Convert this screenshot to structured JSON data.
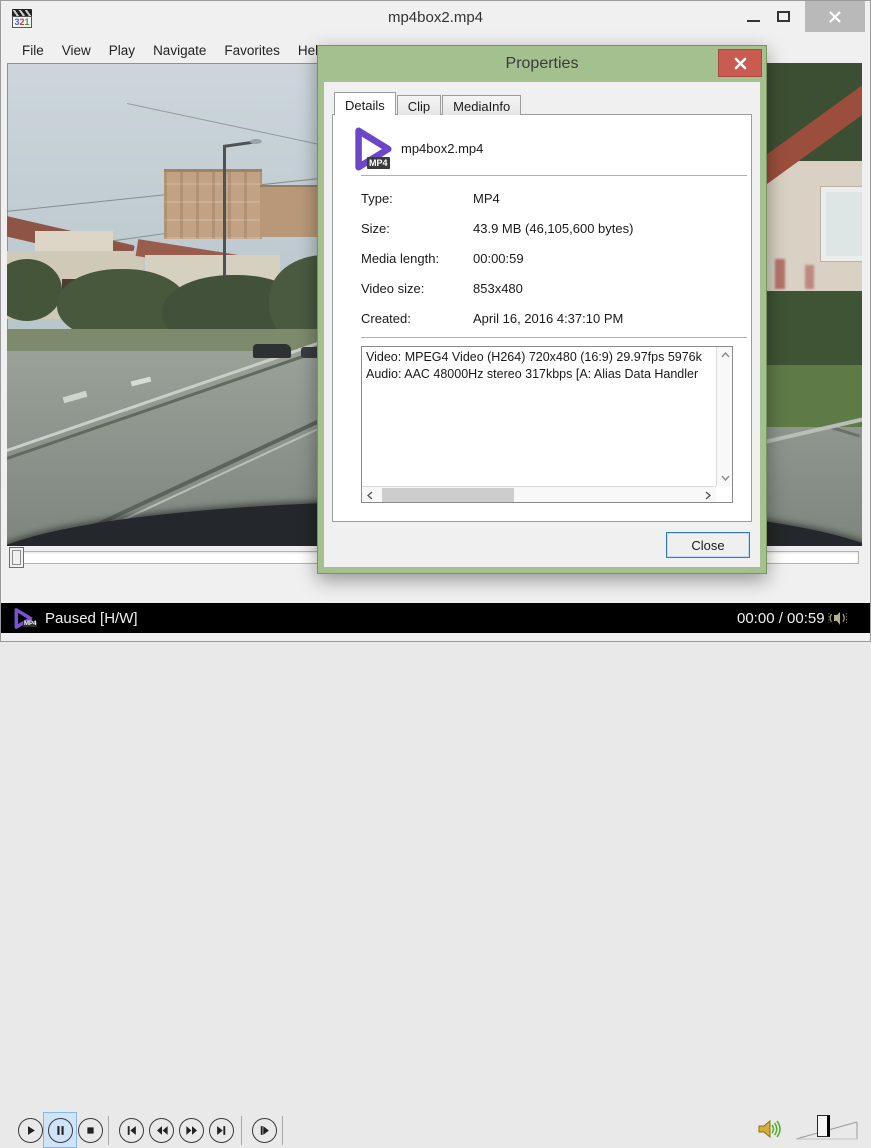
{
  "window": {
    "title": "mp4box2.mp4"
  },
  "menu": {
    "items": [
      "File",
      "View",
      "Play",
      "Navigate",
      "Favorites",
      "Help"
    ]
  },
  "dialog": {
    "title": "Properties",
    "tabs": [
      {
        "label": "Details",
        "active": true
      },
      {
        "label": "Clip",
        "active": false
      },
      {
        "label": "MediaInfo",
        "active": false
      }
    ],
    "file": {
      "name": "mp4box2.mp4",
      "type_badge": "MP4"
    },
    "details": {
      "rows": [
        {
          "label": "Type:",
          "value": "MP4"
        },
        {
          "label": "Size:",
          "value": "43.9 MB (46,105,600 bytes)"
        },
        {
          "label": "Media length:",
          "value": "00:00:59"
        },
        {
          "label": "Video size:",
          "value": "853x480"
        },
        {
          "label": "Created:",
          "value": "April 16, 2016 4:37:10 PM"
        }
      ]
    },
    "stream_info": {
      "line1": "Video: MPEG4 Video (H264) 720x480 (16:9) 29.97fps 5976k",
      "line2": "Audio: AAC 48000Hz stereo 317kbps [A: Alias Data Handler"
    },
    "close_button_label": "Close"
  },
  "transport": {
    "buttons": [
      "play",
      "pause",
      "stop",
      "skip-back",
      "rewind",
      "fast-forward",
      "skip-forward",
      "frame-step"
    ],
    "active_button": "pause"
  },
  "status_bar": {
    "state": "Paused [H/W]",
    "time": "00:00 / 00:59",
    "icon_badge": "MP4"
  },
  "icons": {
    "app": "clapperboard-321-icon",
    "app_badge": "321",
    "file_type": "purple-play-triangle-icon",
    "volume": "speaker-waves-icon",
    "status_audio": "speaker-small-icon"
  },
  "colors": {
    "dialog_frame": "#a4c08f",
    "dialog_close_red": "#ca5b50",
    "accent_purple": "#6b46c8",
    "pause_highlight": "#cfe4f8",
    "default_button_border": "#3579b8",
    "status_bg": "#000000"
  }
}
